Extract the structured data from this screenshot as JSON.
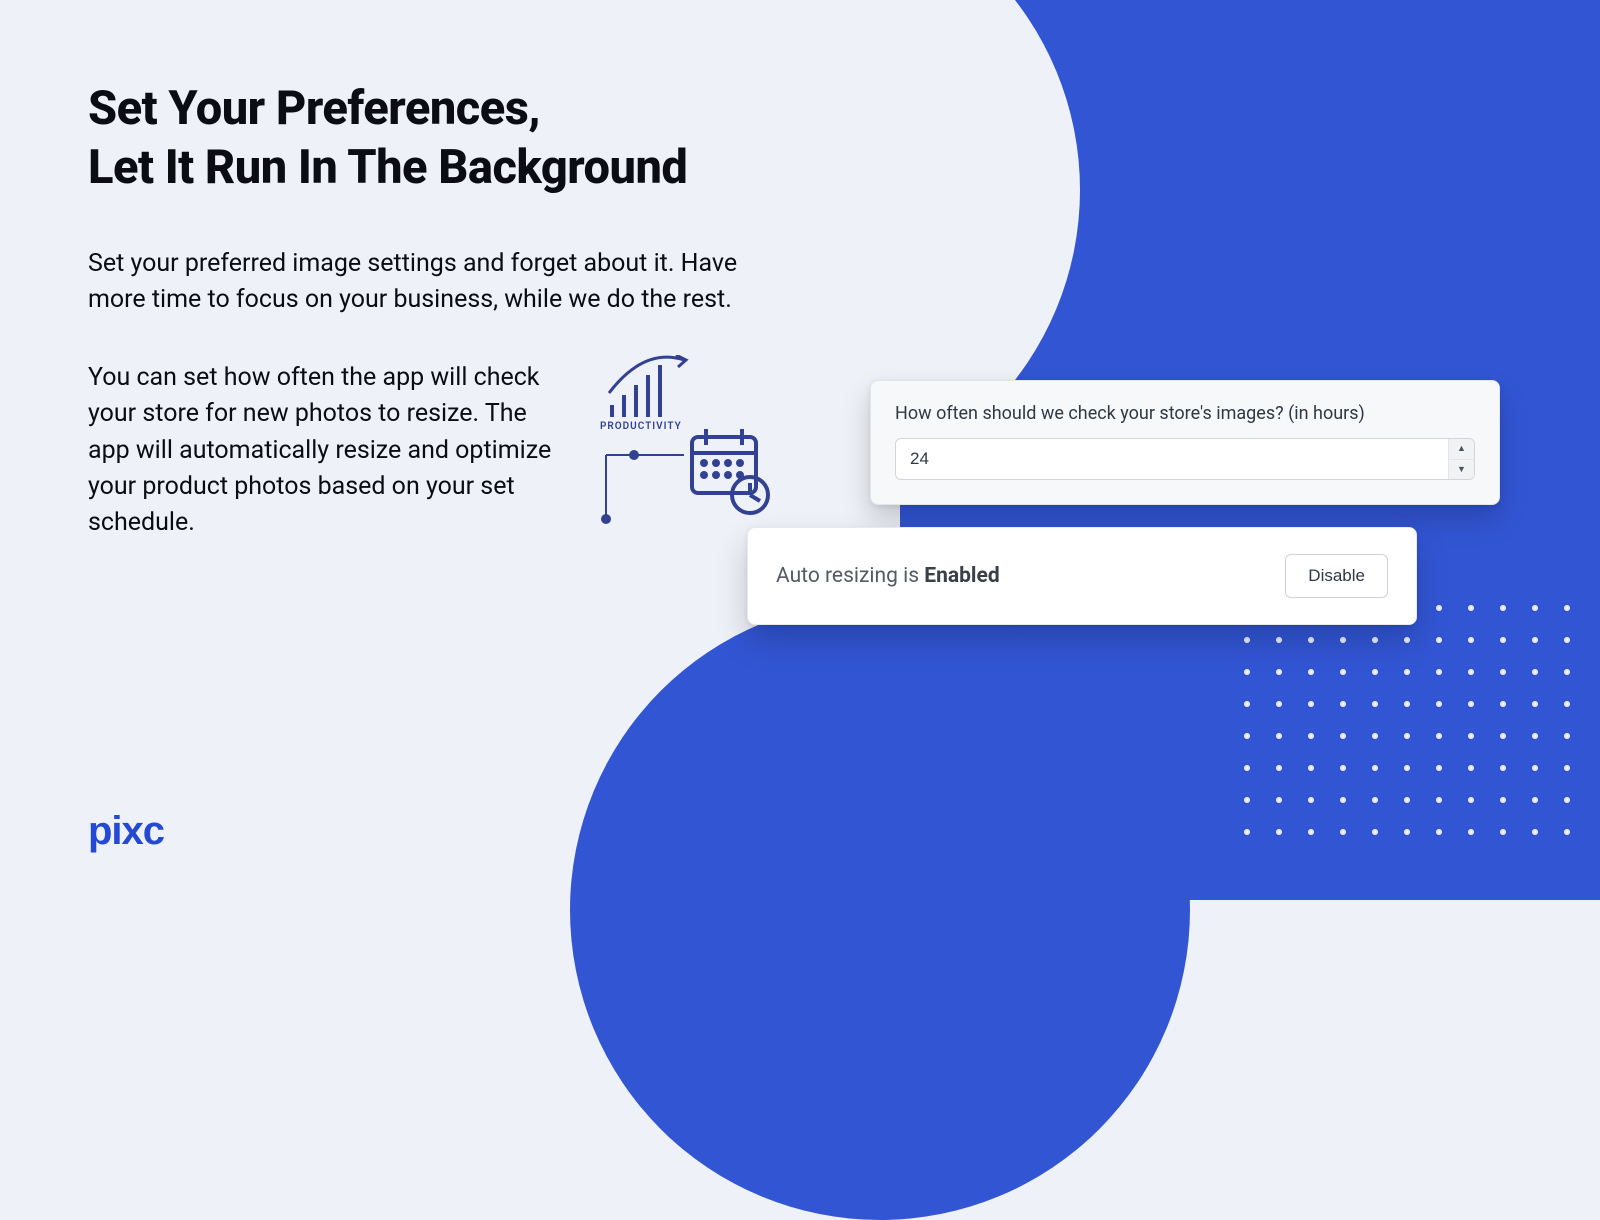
{
  "heading_line1": "Set Your Preferences,",
  "heading_line2": "Let It Run In The Background",
  "subtext": "Set your preferred image settings and forget about it. Have more time to focus on your business, while we do the rest.",
  "bodytext": "You can set how often the app will check your store for new photos to resize. The app will automatically resize and optimize your product photos based on your set schedule.",
  "settings": {
    "label": "How often should we check your store's images? (in hours)",
    "value": "24"
  },
  "status": {
    "prefix": "Auto resizing is ",
    "state": "Enabled",
    "button": "Disable"
  },
  "logo": "pixc",
  "illus_label": "PRODUCTIVITY"
}
